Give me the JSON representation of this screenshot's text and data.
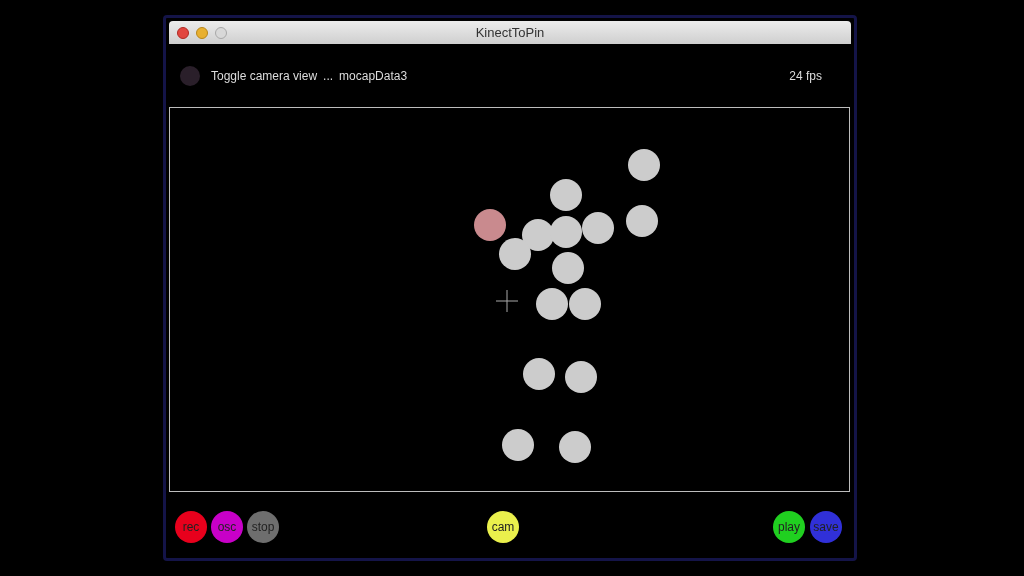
{
  "window": {
    "title": "KinectToPin"
  },
  "header": {
    "toggle_label": "Toggle camera view",
    "separator": "...",
    "file_name": "mocapData3",
    "fps": "24 fps"
  },
  "skeleton": {
    "joints": [
      {
        "color": "#cccccc"
      },
      {
        "color": "#cccccc"
      },
      {
        "color": "#c98a8e"
      },
      {
        "color": "#cccccc"
      },
      {
        "color": "#cccccc"
      },
      {
        "color": "#cccccc"
      },
      {
        "color": "#cccccc"
      },
      {
        "color": "#cccccc"
      },
      {
        "color": "#cccccc"
      },
      {
        "color": "#cccccc"
      },
      {
        "color": "#cccccc"
      },
      {
        "color": "#cccccc"
      },
      {
        "color": "#cccccc"
      },
      {
        "color": "#cccccc"
      },
      {
        "color": "#cccccc"
      }
    ]
  },
  "toolbar": {
    "left": [
      {
        "label": "rec",
        "color": "#e8001c"
      },
      {
        "label": "osc",
        "color": "#c800c8"
      },
      {
        "label": "stop",
        "color": "#6e6e6e"
      }
    ],
    "center": [
      {
        "label": "cam",
        "color": "#eaf04c"
      }
    ],
    "right": [
      {
        "label": "play",
        "color": "#20d020"
      },
      {
        "label": "save",
        "color": "#3030d8"
      }
    ]
  }
}
